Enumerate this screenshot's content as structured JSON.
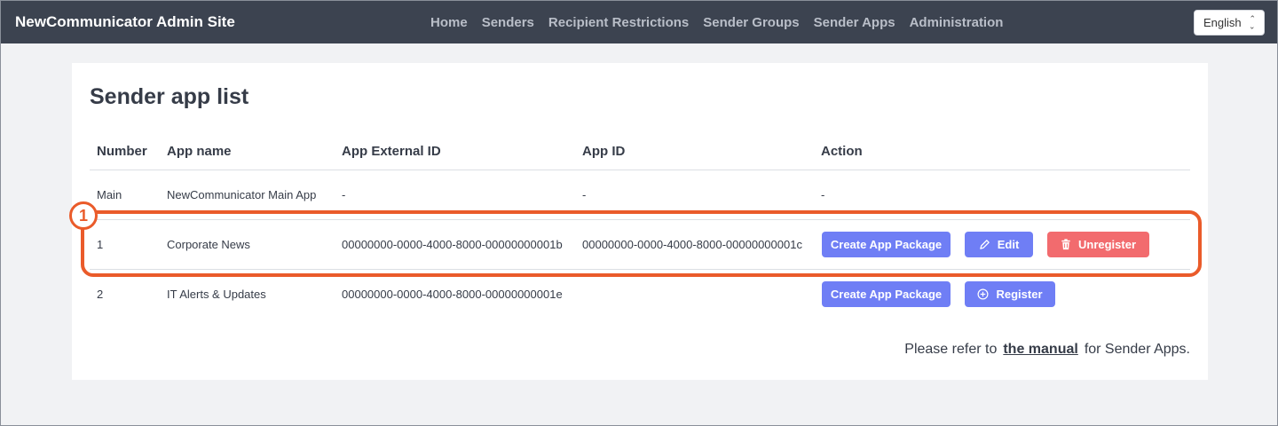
{
  "nav": {
    "brand": "NewCommunicator Admin Site",
    "links": [
      "Home",
      "Senders",
      "Recipient Restrictions",
      "Sender Groups",
      "Sender Apps",
      "Administration"
    ],
    "language": "English"
  },
  "page": {
    "title": "Sender app list"
  },
  "table": {
    "headers": [
      "Number",
      "App name",
      "App External ID",
      "App ID",
      "Action"
    ],
    "rows": [
      {
        "number": "Main",
        "app_name": "NewCommunicator Main App",
        "external_id": "-",
        "app_id": "-",
        "action": "-"
      },
      {
        "number": "1",
        "app_name": "Corporate News",
        "external_id": "00000000-0000-4000-8000-00000000001b",
        "app_id": "00000000-0000-4000-8000-00000000001c",
        "buttons": [
          "Create App Package",
          "Edit",
          "Unregister"
        ]
      },
      {
        "number": "2",
        "app_name": "IT Alerts & Updates",
        "external_id": "00000000-0000-4000-8000-00000000001e",
        "app_id": "",
        "buttons": [
          "Create App Package",
          "Register"
        ]
      }
    ]
  },
  "footer": {
    "prefix": "Please refer to",
    "link": "the manual",
    "suffix": "for Sender Apps."
  },
  "annotation": {
    "callout_number": "1",
    "color": "#ea5b2a"
  },
  "colors": {
    "navbar": "#3c4350",
    "primary": "#6f7ef5",
    "danger": "#f26b6e"
  }
}
